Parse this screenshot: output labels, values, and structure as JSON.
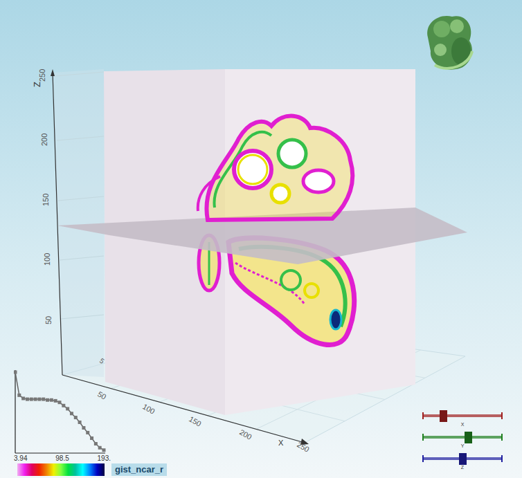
{
  "scene": {
    "axes": {
      "z": {
        "label": "Z",
        "ticks": [
          "50",
          "100",
          "150",
          "200",
          "250"
        ]
      },
      "x": {
        "label": "X",
        "ticks": [
          "50",
          "100",
          "150",
          "200",
          "250"
        ]
      },
      "y": {
        "ticks": [
          "5"
        ]
      }
    }
  },
  "transfer_function": {
    "ticks": [
      "3.94",
      "98.5",
      "193."
    ],
    "values": [
      1.0,
      0.71,
      0.67,
      0.66,
      0.66,
      0.66,
      0.66,
      0.66,
      0.65,
      0.65,
      0.64,
      0.62,
      0.58,
      0.54,
      0.48,
      0.43,
      0.37,
      0.3,
      0.24,
      0.17,
      0.1,
      0.05,
      0.02
    ],
    "colormap": "gist_ncar_r"
  },
  "sliders": [
    {
      "label": "X",
      "level": 0.26,
      "color": "#a02020"
    },
    {
      "label": "Y",
      "level": 0.57,
      "color": "#208020"
    },
    {
      "label": "Z",
      "level": 0.5,
      "color": "#2020a0"
    }
  ]
}
